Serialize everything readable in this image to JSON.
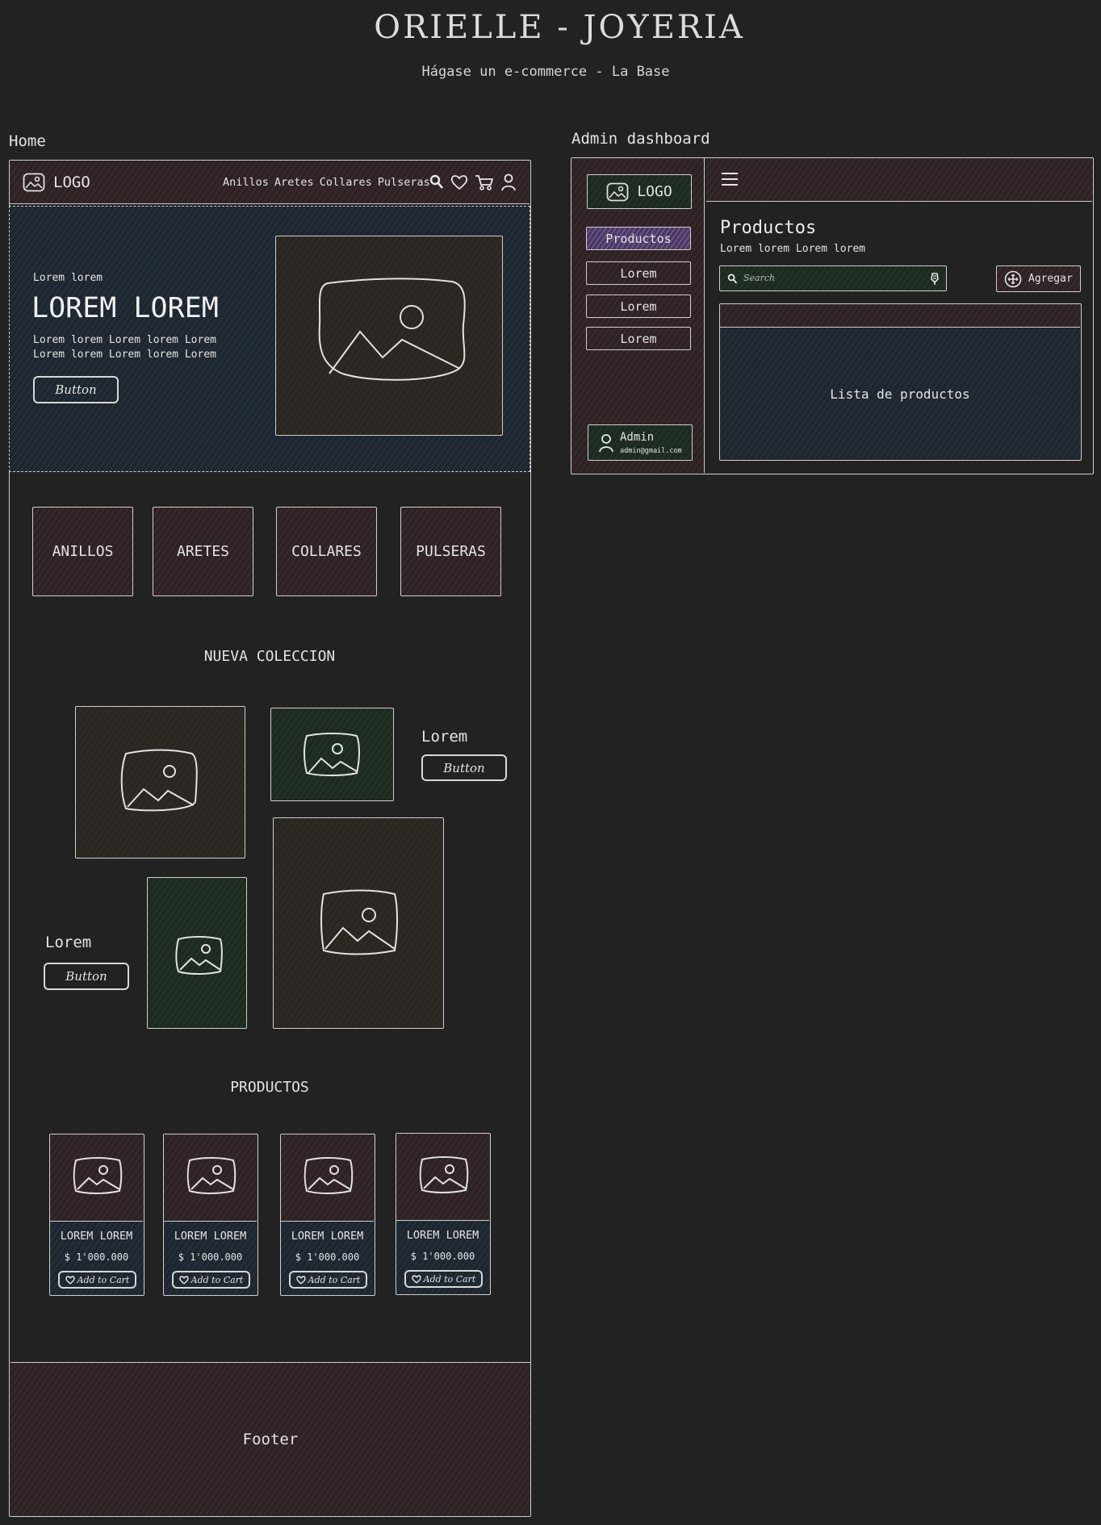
{
  "page": {
    "title": "ORIELLE - JOYERIA",
    "subtitle": "Hágase un e-commerce - La Base"
  },
  "home": {
    "frame_label": "Home",
    "navbar": {
      "logo": "LOGO",
      "links": [
        "Anillos",
        "Aretes",
        "Collares",
        "Pulseras"
      ],
      "icons": [
        "search-icon",
        "heart-icon",
        "cart-icon",
        "user-icon"
      ]
    },
    "hero": {
      "eyebrow": "Lorem lorem",
      "heading": "LOREM LOREM",
      "body_line1": "Lorem lorem Lorem lorem Lorem",
      "body_line2": "Lorem lorem Lorem lorem Lorem",
      "button": "Button"
    },
    "categories": [
      "ANILLOS",
      "ARETES",
      "COLLARES",
      "PULSERAS"
    ],
    "collection": {
      "title": "NUEVA COLECCION",
      "promo1": {
        "label": "Lorem",
        "button": "Button"
      },
      "promo2": {
        "label": "Lorem",
        "button": "Button"
      }
    },
    "products": {
      "title": "PRODUCTOS",
      "items": [
        {
          "name": "LOREM LOREM",
          "price": "$ 1'000.000",
          "cta": "Add to Cart"
        },
        {
          "name": "LOREM LOREM",
          "price": "$ 1'000.000",
          "cta": "Add to Cart"
        },
        {
          "name": "LOREM LOREM",
          "price": "$ 1'000.000",
          "cta": "Add to Cart"
        },
        {
          "name": "LOREM LOREM",
          "price": "$ 1'000.000",
          "cta": "Add to Cart"
        }
      ]
    },
    "footer": "Footer"
  },
  "admin": {
    "frame_label": "Admin dashboard",
    "sidebar": {
      "logo": "LOGO",
      "items": [
        "Productos",
        "Lorem",
        "Lorem",
        "Lorem"
      ],
      "active_index": 0,
      "user": {
        "name": "Admin",
        "email": "admin@gmail.com"
      }
    },
    "main": {
      "title": "Productos",
      "subtitle": "Lorem lorem Lorem lorem",
      "search_placeholder": "Search",
      "add_button": "Agregar",
      "table_placeholder": "Lista de productos"
    }
  },
  "colors": {
    "background": "#222222",
    "stroke": "#cfcfcf",
    "red_fill": "#2d2325",
    "blue_fill": "#1e262f",
    "green_fill": "#1d2a20",
    "brown_fill": "#2a2622",
    "active_fill": "#4a3a63"
  }
}
